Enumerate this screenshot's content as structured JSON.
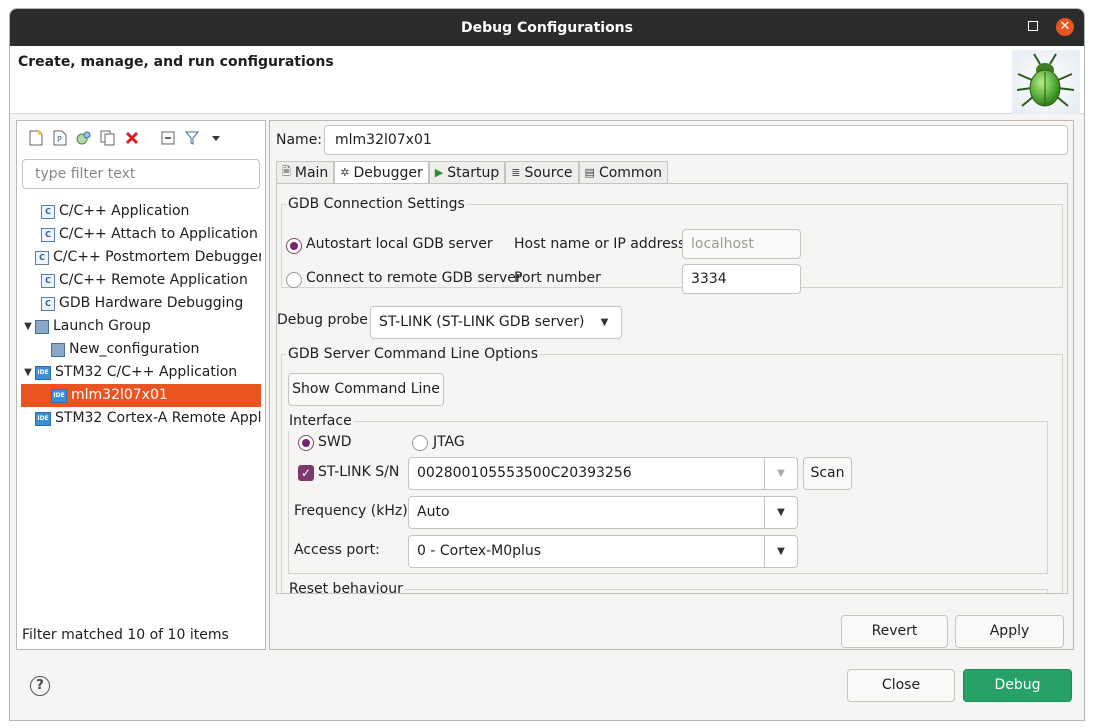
{
  "window": {
    "title": "Debug Configurations",
    "close_glyph": "✕"
  },
  "header": {
    "title": "Create, manage, and run configurations",
    "icon": "bug-icon"
  },
  "left": {
    "filter_placeholder": "type filter text",
    "tree": [
      {
        "label": "C/C++ Application",
        "icon": "c-config-icon",
        "indent": 1
      },
      {
        "label": "C/C++ Attach to Application",
        "icon": "c-config-icon",
        "indent": 1
      },
      {
        "label": "C/C++ Postmortem Debugger",
        "icon": "c-config-icon",
        "indent": 1
      },
      {
        "label": "C/C++ Remote Application",
        "icon": "c-config-icon",
        "indent": 1
      },
      {
        "label": "GDB Hardware Debugging",
        "icon": "c-config-icon",
        "indent": 1
      },
      {
        "label": "Launch Group",
        "icon": "launch-group-icon",
        "indent": 0,
        "expanded": true
      },
      {
        "label": "New_configuration",
        "icon": "launch-group-icon",
        "indent": 2
      },
      {
        "label": "STM32 C/C++ Application",
        "icon": "ide-icon",
        "indent": 0,
        "expanded": true
      },
      {
        "label": "mlm32l07x01",
        "icon": "ide-icon",
        "indent": 2,
        "selected": true
      },
      {
        "label": "STM32 Cortex-A Remote Appli",
        "icon": "ide-icon",
        "indent": 1
      }
    ],
    "status": "Filter matched 10 of 10 items"
  },
  "right": {
    "name_label": "Name:",
    "name_value": "mlm32l07x01",
    "tabs": [
      {
        "label": "Main",
        "icon": "main-tab-icon"
      },
      {
        "label": "Debugger",
        "icon": "debugger-tab-icon",
        "active": true
      },
      {
        "label": "Startup",
        "icon": "startup-tab-icon"
      },
      {
        "label": "Source",
        "icon": "source-tab-icon"
      },
      {
        "label": "Common",
        "icon": "common-tab-icon"
      }
    ],
    "gdb_conn": {
      "title": "GDB Connection Settings",
      "autostart_label": "Autostart local GDB server",
      "connect_label": "Connect to remote GDB server",
      "host_label": "Host name or IP address",
      "host_value": "localhost",
      "port_label": "Port number",
      "port_value": "3334"
    },
    "debug_probe": {
      "label": "Debug probe",
      "value": "ST-LINK (ST-LINK GDB server)"
    },
    "server_opts": {
      "title": "GDB Server Command Line Options",
      "show_cmd_button": "Show Command Line"
    },
    "interface": {
      "title": "Interface",
      "swd_label": "SWD",
      "jtag_label": "JTAG",
      "stlink_sn_label": "ST-LINK S/N",
      "stlink_sn_value": "002800105553500C20393256",
      "scan_button": "Scan",
      "frequency_label": "Frequency (kHz):",
      "frequency_value": "Auto",
      "access_port_label": "Access port:",
      "access_port_value": "0 - Cortex-M0plus"
    },
    "reset": {
      "title": "Reset behaviour"
    },
    "revert_button": "Revert",
    "apply_button": "Apply"
  },
  "footer": {
    "help_glyph": "?",
    "close_button": "Close",
    "debug_button": "Debug"
  },
  "colors": {
    "selection": "#e95420",
    "debug_button": "#26a269",
    "radio_checked": "#77216f"
  }
}
